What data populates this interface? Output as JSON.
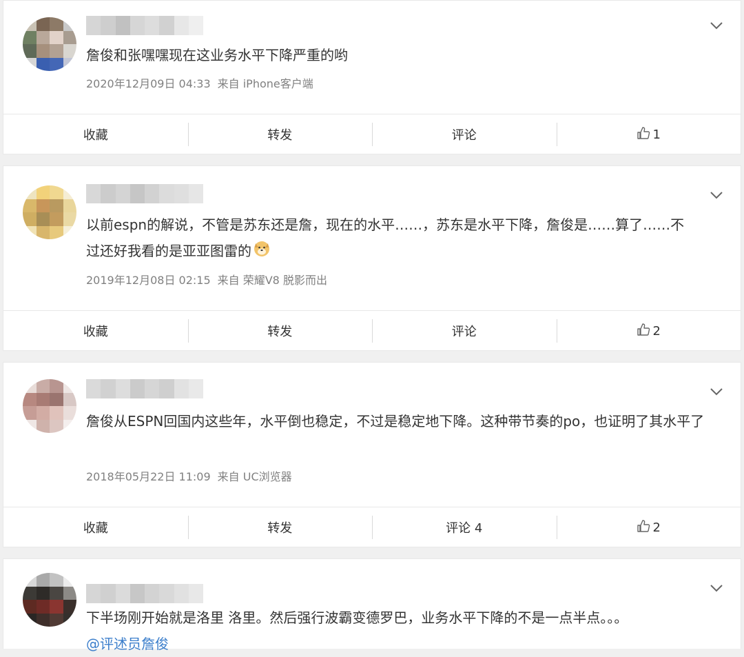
{
  "posts": [
    {
      "text": "詹俊和张嘿嘿现在这业务水平下降严重的哟",
      "time": "2020年12月09日 04:33",
      "source": "来自 iPhone客户端",
      "actions": {
        "fav": "收藏",
        "repost": "转发",
        "comment": "评论",
        "like": "1"
      }
    },
    {
      "text": "以前espn的解说，不管是苏东还是詹，现在的水平……，苏东是水平下降，詹俊是……算了……不过还好我看的是亚亚图雷的",
      "emoji": "doge-emoji",
      "time": "2019年12月08日 02:15",
      "source": "来自 荣耀V8 脱影而出",
      "actions": {
        "fav": "收藏",
        "repost": "转发",
        "comment": "评论",
        "like": "2"
      }
    },
    {
      "text": "詹俊从ESPN回国内这些年，水平倒也稳定，不过是稳定地下降。这种带节奏的po，也证明了其水平了",
      "time": "2018年05月22日 11:09",
      "source": "来自 UC浏览器",
      "actions": {
        "fav": "收藏",
        "repost": "转发",
        "comment": "评论 4",
        "like": "2"
      }
    },
    {
      "text": "下半场刚开始就是洛里 洛里。然后强行波霸变德罗巴，业务水平下降的不是一点半点。。。",
      "mention": "@评述员詹俊"
    }
  ],
  "icons": {
    "expand": "chevron-down-icon",
    "like": "thumbs-up-icon"
  },
  "colors": {
    "text": "#333333",
    "meta": "#808080",
    "link": "#3b7ecb",
    "background": "#f0f0f0"
  }
}
